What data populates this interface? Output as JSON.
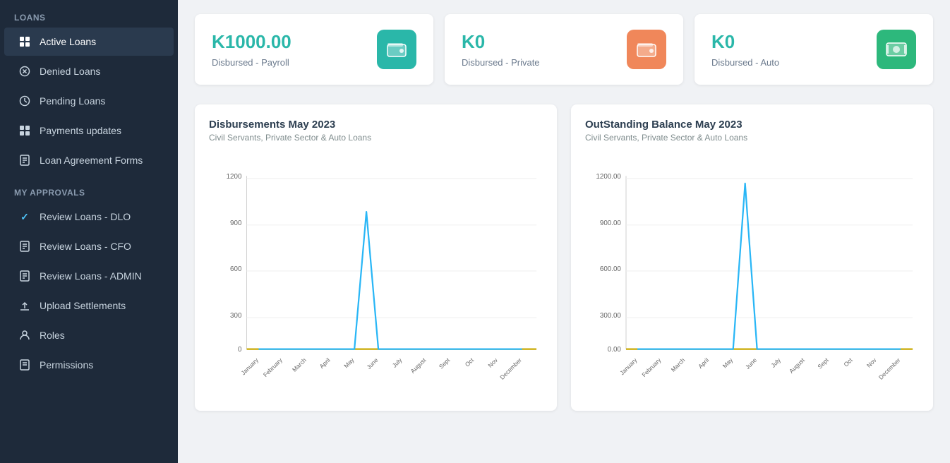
{
  "sidebar": {
    "loans_section": "Loans",
    "approvals_section": "My Approvals",
    "items": [
      {
        "id": "active-loans",
        "label": "Active Loans",
        "icon": "grid",
        "active": true
      },
      {
        "id": "denied-loans",
        "label": "Denied Loans",
        "icon": "circle-x"
      },
      {
        "id": "pending-loans",
        "label": "Pending Loans",
        "icon": "clock"
      },
      {
        "id": "payments-updates",
        "label": "Payments updates",
        "icon": "grid-sm"
      },
      {
        "id": "loan-agreement-forms",
        "label": "Loan Agreement Forms",
        "icon": "doc"
      },
      {
        "id": "review-loans-dlo",
        "label": "Review Loans - DLO",
        "icon": "check",
        "check": true
      },
      {
        "id": "review-loans-cfo",
        "label": "Review Loans - CFO",
        "icon": "doc2"
      },
      {
        "id": "review-loans-admin",
        "label": "Review Loans - ADMIN",
        "icon": "doc3"
      },
      {
        "id": "upload-settlements",
        "label": "Upload Settlements",
        "icon": "upload"
      },
      {
        "id": "roles",
        "label": "Roles",
        "icon": "person"
      },
      {
        "id": "permissions",
        "label": "Permissions",
        "icon": "doc4"
      }
    ]
  },
  "stat_cards": [
    {
      "value": "K1000.00",
      "label": "Disbursed - Payroll",
      "icon_type": "wallet",
      "icon_class": "icon-teal"
    },
    {
      "value": "K0",
      "label": "Disbursed - Private",
      "icon_type": "wallet",
      "icon_class": "icon-orange"
    },
    {
      "value": "K0",
      "label": "Disbursed - Auto",
      "icon_type": "money",
      "icon_class": "icon-green"
    }
  ],
  "charts": [
    {
      "title": "Disbursements May 2023",
      "subtitle": "Civil Servants, Private Sector & Auto Loans",
      "y_max": 1200,
      "y_ticks": [
        "1200",
        "900",
        "600",
        "300",
        "0"
      ],
      "months": [
        "January",
        "February",
        "March",
        "April",
        "May",
        "June",
        "July",
        "August",
        "Sept",
        "Oct",
        "Nov",
        "December"
      ],
      "data_points": [
        0,
        0,
        0,
        0,
        950,
        0,
        0,
        0,
        0,
        0,
        0,
        0
      ]
    },
    {
      "title": "OutStanding Balance May 2023",
      "subtitle": "Civil Servants, Private Sector & Auto Loans",
      "y_max": 1200,
      "y_ticks": [
        "1200.00",
        "900.00",
        "600.00",
        "300.00",
        "0.00"
      ],
      "months": [
        "January",
        "February",
        "March",
        "April",
        "May",
        "June",
        "July",
        "August",
        "Sept",
        "Oct",
        "Nov",
        "December"
      ],
      "data_points": [
        0,
        0,
        0,
        0,
        1150,
        0,
        0,
        0,
        0,
        0,
        0,
        0
      ]
    }
  ]
}
